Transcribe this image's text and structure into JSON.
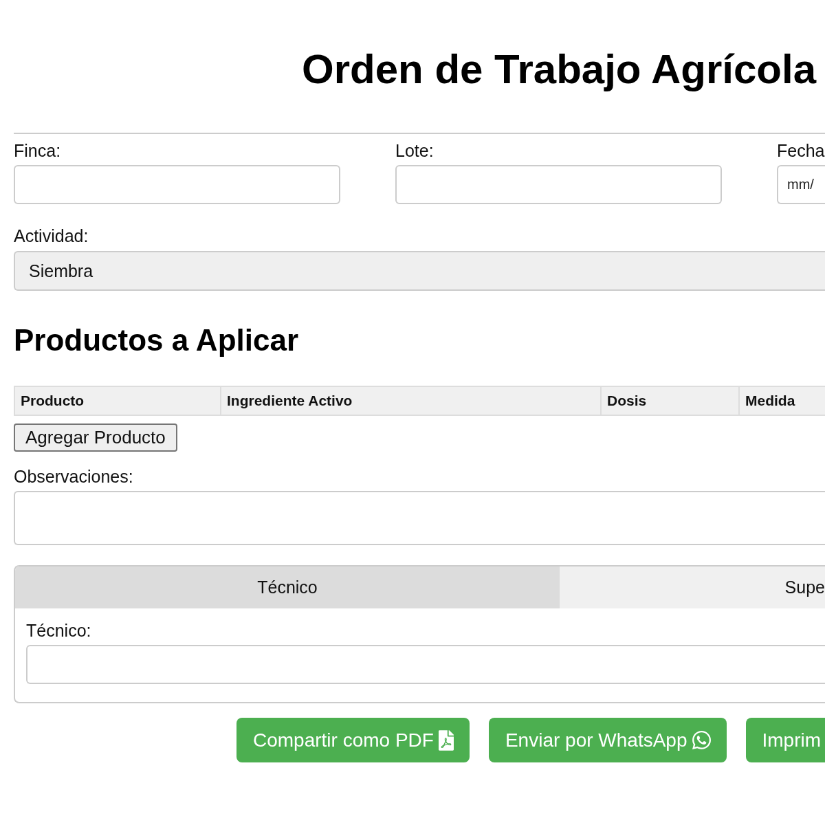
{
  "title": "Orden de Trabajo Agrícola",
  "fields": [
    {
      "label": "Finca:"
    },
    {
      "label": "Lote:"
    },
    {
      "label": "Fecha",
      "placeholder": "mm/"
    }
  ],
  "activity": {
    "label": "Actividad:",
    "value": "Siembra"
  },
  "products": {
    "heading": "Productos a Aplicar",
    "columns": [
      "Producto",
      "Ingrediente Activo",
      "Dosis",
      "Medida"
    ],
    "add_button": "Agregar Producto"
  },
  "observations": {
    "label": "Observaciones:"
  },
  "signatures": {
    "tabs": [
      {
        "label": "Técnico",
        "selected": true
      },
      {
        "label": "Supe",
        "selected": false
      }
    ],
    "field_label": "Técnico:"
  },
  "actions": [
    {
      "label": "Compartir como PDF",
      "kind": "pdf"
    },
    {
      "label": "Enviar por WhatsApp",
      "kind": "message"
    },
    {
      "label": "Imprim",
      "kind": "text"
    }
  ]
}
